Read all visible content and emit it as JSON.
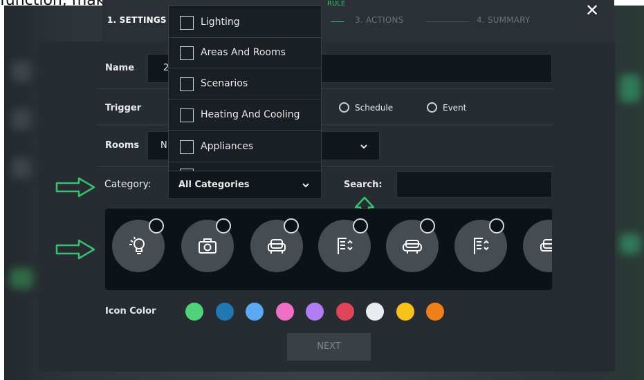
{
  "caption": "function, making it easier to find the desired icon.",
  "stepper": {
    "rule_label": "RULE",
    "steps": [
      "1. SETTINGS",
      "3. ACTIONS",
      "4. SUMMARY"
    ]
  },
  "form": {
    "name_label": "Name",
    "name_value": "2",
    "trigger_label": "Trigger",
    "trigger_options": [
      "Schedule",
      "Event"
    ],
    "rooms_label": "Rooms",
    "rooms_value": "N",
    "category_label": "Category:",
    "category_value": "All Categories",
    "search_label": "Search:",
    "search_value": ""
  },
  "category_dropdown": {
    "items": [
      "Lighting",
      "Areas And Rooms",
      "Scenarios",
      "Heating And Cooling",
      "Appliances"
    ]
  },
  "icons": [
    "lightbulb-icon",
    "camera-icon",
    "armchair-icon",
    "list-sort-icon",
    "sofa-icon",
    "list-sort-icon",
    "armchair-icon"
  ],
  "icon_color": {
    "label": "Icon Color",
    "swatches": [
      "#4fd27a",
      "#1f78b4",
      "#5aaaf5",
      "#f06ec4",
      "#b27cf2",
      "#e04459",
      "#e9ecef",
      "#f6c21b",
      "#ef7f1a"
    ]
  },
  "next_label": "NEXT",
  "colors": {
    "arrow": "#35c271",
    "panel": "#262c31"
  }
}
